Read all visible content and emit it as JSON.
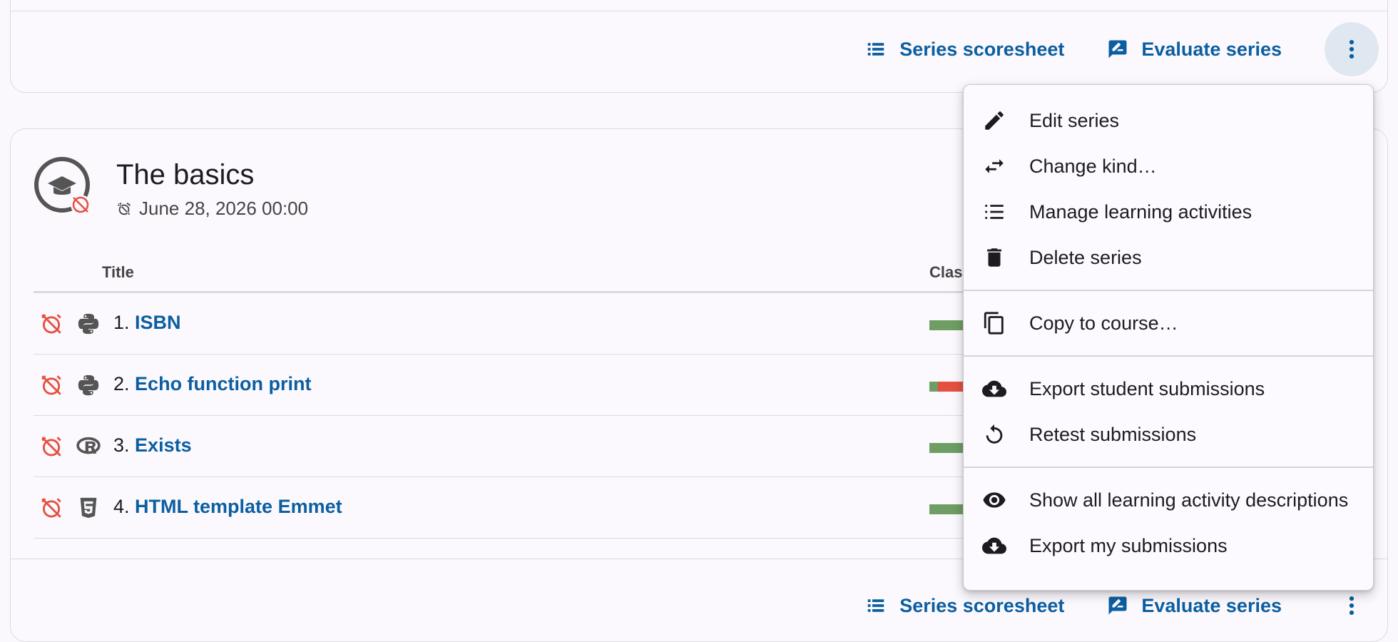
{
  "top_card": {
    "scoresheet_label": "Series scoresheet",
    "evaluate_label": "Evaluate series"
  },
  "series": {
    "title": "The basics",
    "deadline": "June 28, 2026 00:00",
    "table_headers": {
      "title": "Title",
      "class": "Class"
    },
    "activities": [
      {
        "num": "1.",
        "title": "ISBN",
        "type_icon": "python-icon",
        "progress_red": 0
      },
      {
        "num": "2.",
        "title": "Echo function print",
        "type_icon": "python-icon",
        "progress_red": 0.12
      },
      {
        "num": "3.",
        "title": "Exists",
        "type_icon": "r-language-icon",
        "progress_red": 0
      },
      {
        "num": "4.",
        "title": "HTML template Emmet",
        "type_icon": "html5-icon",
        "progress_red": 0
      }
    ],
    "scoresheet_label": "Series scoresheet",
    "evaluate_label": "Evaluate series"
  },
  "menu": {
    "groups": [
      [
        {
          "label": "Edit series",
          "icon": "pencil-icon"
        },
        {
          "label": "Change kind…",
          "icon": "swap-icon"
        },
        {
          "label": "Manage learning activities",
          "icon": "list-icon"
        },
        {
          "label": "Delete series",
          "icon": "trash-icon"
        }
      ],
      [
        {
          "label": "Copy to course…",
          "icon": "copy-icon"
        }
      ],
      [
        {
          "label": "Export student submissions",
          "icon": "cloud-download-icon"
        },
        {
          "label": "Retest submissions",
          "icon": "restart-icon"
        }
      ],
      [
        {
          "label": "Show all learning activity descriptions",
          "icon": "eye-icon"
        },
        {
          "label": "Export my submissions",
          "icon": "cloud-download-icon"
        }
      ]
    ]
  },
  "colors": {
    "link": "#0b5fa0",
    "progress_green": "#6e9e64",
    "progress_red": "#e55040",
    "alarm_red": "#e55040"
  }
}
